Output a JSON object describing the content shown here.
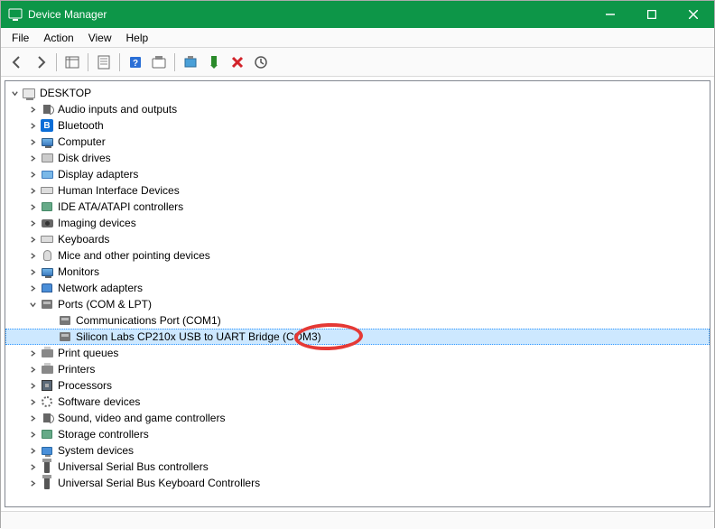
{
  "window": {
    "title": "Device Manager"
  },
  "menu": {
    "items": [
      "File",
      "Action",
      "View",
      "Help"
    ]
  },
  "tree": {
    "root": {
      "label": "DESKTOP",
      "expanded": true,
      "iconClass": "root-icon",
      "iconName": "computer-icon"
    },
    "categories": [
      {
        "label": "Audio inputs and outputs",
        "expanded": false,
        "iconClass": "ico-audio",
        "iconName": "audio-icon"
      },
      {
        "label": "Bluetooth",
        "expanded": false,
        "iconClass": "ico-bluetooth",
        "iconName": "bluetooth-icon"
      },
      {
        "label": "Computer",
        "expanded": false,
        "iconClass": "ico-monitor",
        "iconName": "monitor-icon"
      },
      {
        "label": "Disk drives",
        "expanded": false,
        "iconClass": "ico-disk",
        "iconName": "disk-icon"
      },
      {
        "label": "Display adapters",
        "expanded": false,
        "iconClass": "ico-display",
        "iconName": "display-icon"
      },
      {
        "label": "Human Interface Devices",
        "expanded": false,
        "iconClass": "ico-keyboard",
        "iconName": "hid-icon"
      },
      {
        "label": "IDE ATA/ATAPI controllers",
        "expanded": false,
        "iconClass": "ico-cable",
        "iconName": "ide-icon"
      },
      {
        "label": "Imaging devices",
        "expanded": false,
        "iconClass": "ico-camera",
        "iconName": "camera-icon"
      },
      {
        "label": "Keyboards",
        "expanded": false,
        "iconClass": "ico-keyboard",
        "iconName": "keyboard-icon"
      },
      {
        "label": "Mice and other pointing devices",
        "expanded": false,
        "iconClass": "ico-mouse",
        "iconName": "mouse-icon"
      },
      {
        "label": "Monitors",
        "expanded": false,
        "iconClass": "ico-monitor",
        "iconName": "monitor-icon"
      },
      {
        "label": "Network adapters",
        "expanded": false,
        "iconClass": "ico-network",
        "iconName": "network-icon"
      },
      {
        "label": "Ports (COM & LPT)",
        "expanded": true,
        "iconClass": "ico-port",
        "iconName": "ports-icon",
        "children": [
          {
            "label": "Communications Port (COM1)",
            "selected": false,
            "iconClass": "ico-port",
            "iconName": "port-icon"
          },
          {
            "label": "Silicon Labs CP210x USB to UART Bridge (COM3)",
            "selected": true,
            "iconClass": "ico-port",
            "iconName": "port-icon",
            "circled": true
          }
        ]
      },
      {
        "label": "Print queues",
        "expanded": false,
        "iconClass": "ico-printer",
        "iconName": "printer-icon"
      },
      {
        "label": "Printers",
        "expanded": false,
        "iconClass": "ico-printer",
        "iconName": "printer-icon"
      },
      {
        "label": "Processors",
        "expanded": false,
        "iconClass": "ico-chip",
        "iconName": "cpu-icon"
      },
      {
        "label": "Software devices",
        "expanded": false,
        "iconClass": "ico-gear",
        "iconName": "software-icon"
      },
      {
        "label": "Sound, video and game controllers",
        "expanded": false,
        "iconClass": "ico-audio",
        "iconName": "sound-icon"
      },
      {
        "label": "Storage controllers",
        "expanded": false,
        "iconClass": "ico-cable",
        "iconName": "storage-icon"
      },
      {
        "label": "System devices",
        "expanded": false,
        "iconClass": "ico-computer",
        "iconName": "system-icon"
      },
      {
        "label": "Universal Serial Bus controllers",
        "expanded": false,
        "iconClass": "ico-usb",
        "iconName": "usb-icon"
      },
      {
        "label": "Universal Serial Bus Keyboard Controllers",
        "expanded": false,
        "iconClass": "ico-usb",
        "iconName": "usb-keyboard-icon"
      }
    ]
  }
}
